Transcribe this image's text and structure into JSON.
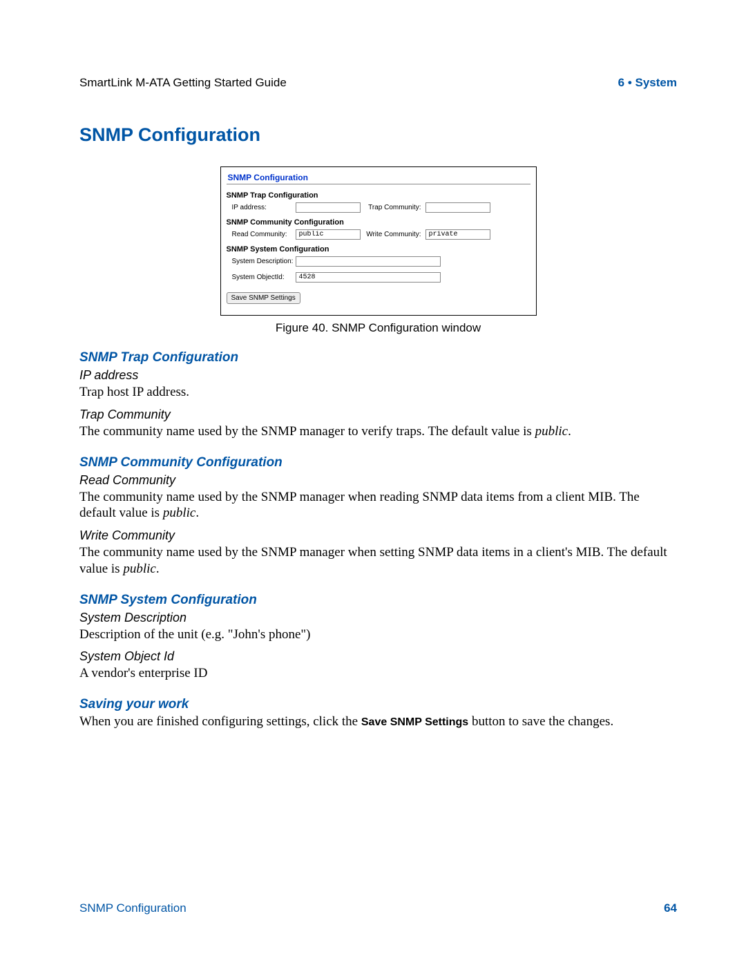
{
  "header": {
    "left": "SmartLink M-ATA Getting Started Guide",
    "right": "6 • System"
  },
  "page_title": "SNMP Configuration",
  "figure": {
    "panel_title": "SNMP Configuration",
    "trap_section": "SNMP Trap Configuration",
    "ip_label": "IP address:",
    "ip_value": "",
    "trap_comm_label": "Trap Community:",
    "trap_comm_value": "",
    "community_section": "SNMP Community Configuration",
    "read_label": "Read Community:",
    "read_value": "public",
    "write_label": "Write Community:",
    "write_value": "private",
    "system_section": "SNMP System Configuration",
    "sysdesc_label": "System Description:",
    "sysdesc_value": "",
    "sysoid_label": "System ObjectId:",
    "sysoid_value": "4528",
    "button": "Save SNMP Settings",
    "caption": "Figure 40. SNMP Configuration window"
  },
  "sec_trap": {
    "title": "SNMP Trap Configuration",
    "ip_head": "IP address",
    "ip_body": "Trap host IP address.",
    "tc_head": "Trap Community",
    "tc_body_1": "The community name used by the SNMP manager to verify traps. The default value is ",
    "tc_body_ital": "public",
    "tc_body_2": "."
  },
  "sec_comm": {
    "title": "SNMP Community Configuration",
    "rc_head": "Read Community",
    "rc_body_1": "The community name used by the SNMP manager when reading SNMP data items from a client MIB. The default value is ",
    "rc_body_ital": "public",
    "rc_body_2": ".",
    "wc_head": "Write Community",
    "wc_body_1": "The community name used by the SNMP manager when setting SNMP data items in a client's MIB. The default value is ",
    "wc_body_ital": "public",
    "wc_body_2": "."
  },
  "sec_sys": {
    "title": "SNMP System Configuration",
    "sd_head": "System Description",
    "sd_body": "Description of the unit (e.g. \"John's phone\")",
    "sid_head": "System Object Id",
    "sid_body": "A vendor's enterprise ID"
  },
  "sec_save": {
    "title": "Saving your work",
    "body_1": "When you are finished configuring settings, click the ",
    "body_bold": "Save SNMP Settings",
    "body_2": " button to save the changes."
  },
  "footer": {
    "left": "SNMP Configuration",
    "right": "64"
  }
}
